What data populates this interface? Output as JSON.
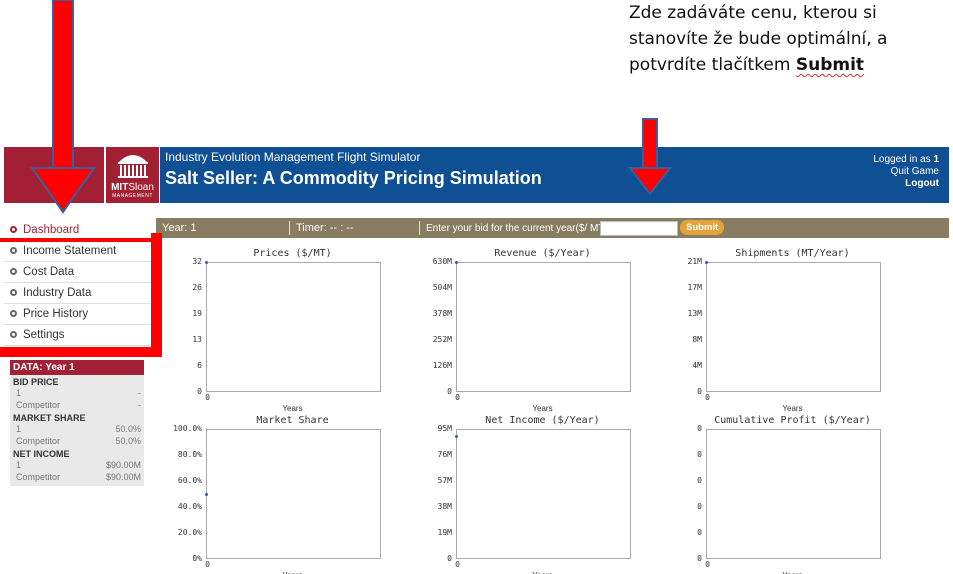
{
  "note": {
    "line1": "Zde zadáváte cenu, kterou si",
    "line2": "stanovíte že bude optimální, a",
    "line3_prefix": "potvrdíte tlačítkem ",
    "line3_bold": "Submit"
  },
  "header": {
    "logo_mit": "MIT",
    "logo_sloan": "Sloan",
    "logo_mgmt": "MANAGEMENT",
    "kicker": "Industry Evolution Management Flight Simulator",
    "title": "Salt Seller: A Commodity Pricing Simulation",
    "logged_in_prefix": "Logged in as ",
    "logged_in_user": "1",
    "quit": "Quit Game",
    "logout": "Logout"
  },
  "nav": {
    "items": [
      {
        "label": "Dashboard"
      },
      {
        "label": "Income Statement"
      },
      {
        "label": "Cost Data"
      },
      {
        "label": "Industry Data"
      },
      {
        "label": "Price History"
      },
      {
        "label": "Settings"
      }
    ]
  },
  "data_panel": {
    "header": "DATA: Year 1",
    "bid_price": {
      "title": "BID PRICE",
      "rows": [
        {
          "label": "1",
          "value": "-"
        },
        {
          "label": "Competitor",
          "value": "-"
        }
      ]
    },
    "market_share": {
      "title": "MARKET SHARE",
      "rows": [
        {
          "label": "1",
          "value": "50.0%"
        },
        {
          "label": "Competitor",
          "value": "50.0%"
        }
      ]
    },
    "net_income": {
      "title": "NET INCOME",
      "rows": [
        {
          "label": "1",
          "value": "$90.00M"
        },
        {
          "label": "Competitor",
          "value": "$90.00M"
        }
      ]
    }
  },
  "toolbar": {
    "year": "Year: 1",
    "timer": "Timer: -- : --",
    "bid_label": "Enter your bid for the current year($/ MT):",
    "bid_value": "",
    "submit": "Submit"
  },
  "chart_data": [
    {
      "type": "scatter",
      "title": "Prices ($/MT)",
      "xlabel": "Years",
      "ytick_labels": [
        "32",
        "26",
        "19",
        "13",
        "6",
        "0"
      ],
      "xtick_labels": [
        "0"
      ],
      "points": [
        [
          0,
          32
        ]
      ]
    },
    {
      "type": "scatter",
      "title": "Revenue ($/Year)",
      "xlabel": "Years",
      "ytick_labels": [
        "630M",
        "504M",
        "378M",
        "252M",
        "126M",
        "0"
      ],
      "xtick_labels": [
        "0"
      ],
      "points": [
        [
          0,
          630
        ]
      ]
    },
    {
      "type": "scatter",
      "title": "Shipments (MT/Year)",
      "xlabel": "Years",
      "ytick_labels": [
        "21M",
        "17M",
        "13M",
        "8M",
        "4M",
        "0"
      ],
      "xtick_labels": [
        "0"
      ],
      "points": [
        [
          0,
          21
        ]
      ]
    },
    {
      "type": "scatter",
      "title": "Market Share",
      "xlabel": "Years",
      "ytick_labels": [
        "100.0%",
        "80.0%",
        "60.0%",
        "40.0%",
        "20.0%",
        "0%"
      ],
      "xtick_labels": [
        "0"
      ],
      "points": [
        [
          0,
          50
        ]
      ]
    },
    {
      "type": "scatter",
      "title": "Net Income ($/Year)",
      "xlabel": "Years",
      "ytick_labels": [
        "95M",
        "76M",
        "57M",
        "38M",
        "19M",
        "0"
      ],
      "xtick_labels": [
        "0"
      ],
      "points": [
        [
          0,
          90
        ]
      ]
    },
    {
      "type": "line",
      "title": "Cumulative Profit ($/Year)",
      "xlabel": "Years",
      "ytick_labels": [
        "0",
        "0",
        "0",
        "0",
        "0",
        "0"
      ],
      "xtick_labels": [
        "0"
      ],
      "points": []
    }
  ],
  "colors": {
    "mit_red": "#a31f34",
    "header_blue": "#0f4f94",
    "toolbar_brown": "#887c63",
    "submit_orange": "#e2a33b",
    "annotation_red": "#ff0000"
  }
}
